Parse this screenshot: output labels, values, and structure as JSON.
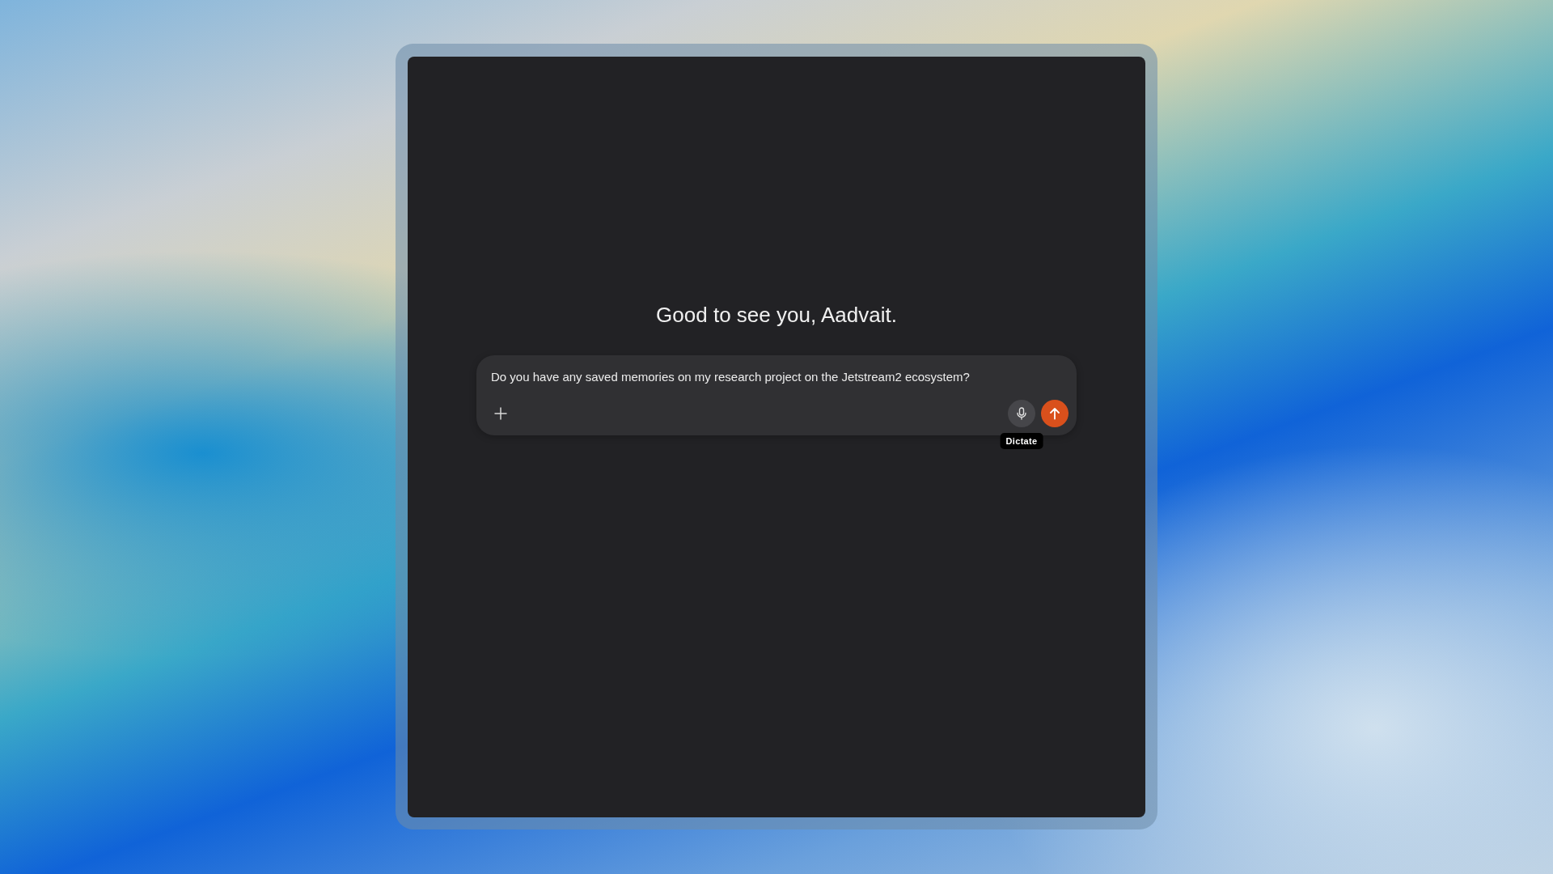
{
  "greeting": "Good to see you, Aadvait.",
  "composer": {
    "value": "Do you have any saved memories on my research project on the Jetstream2 ecosystem?",
    "tooltip": "Dictate"
  }
}
